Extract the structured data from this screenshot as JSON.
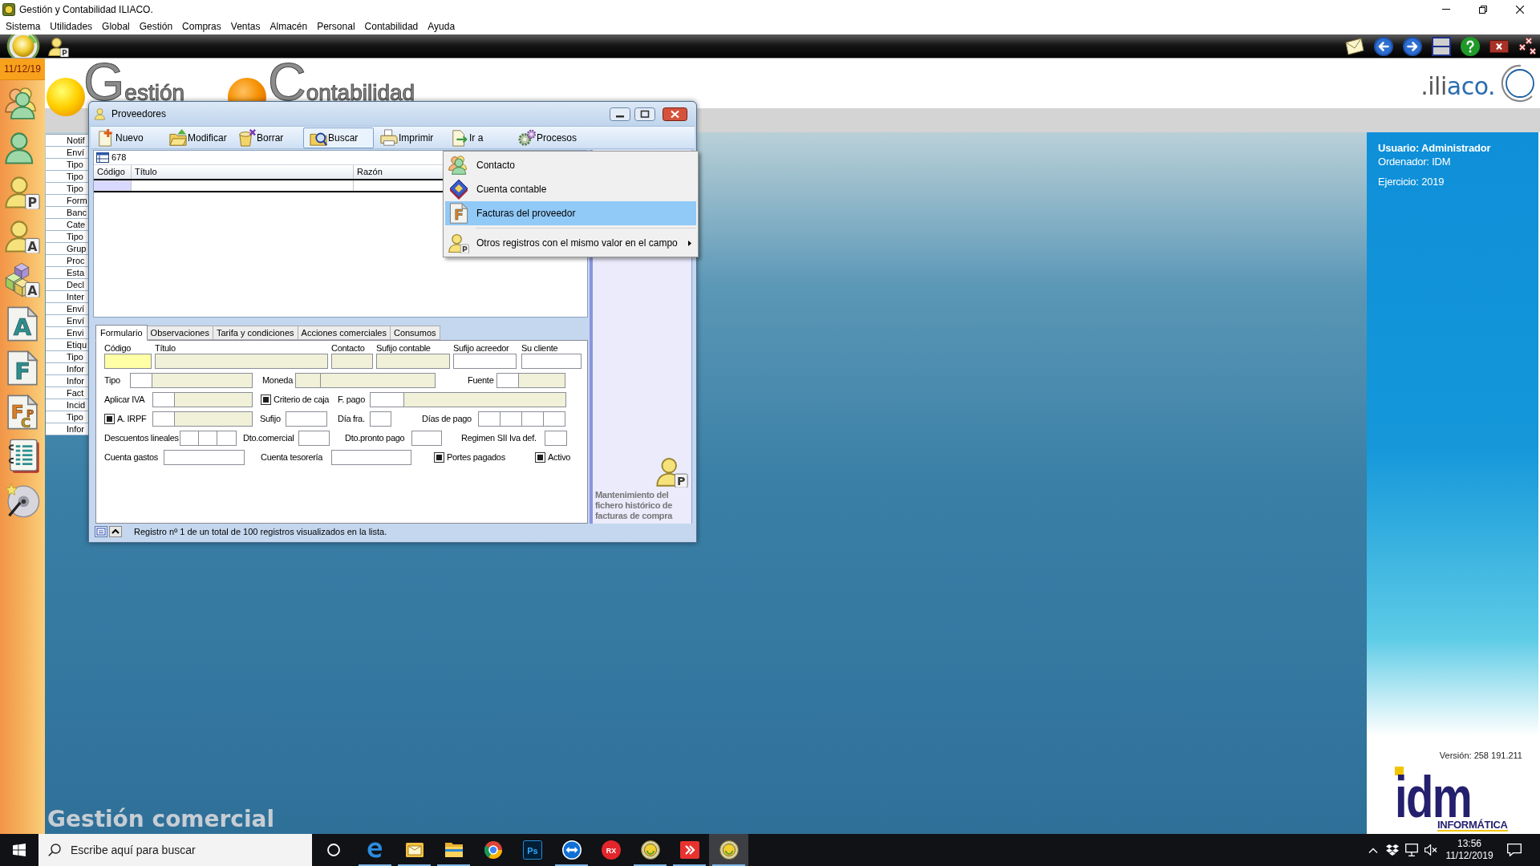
{
  "window": {
    "title": "Gestión y Contabilidad ILIACO."
  },
  "menu": [
    "Sistema",
    "Utilidades",
    "Global",
    "Gestión",
    "Compras",
    "Ventas",
    "Almacén",
    "Personal",
    "Contabilidad",
    "Ayuda"
  ],
  "quick_access": [
    {
      "kind": "orb"
    },
    {
      "kind": "user",
      "letters": [
        "P"
      ]
    }
  ],
  "sidebar": {
    "date": "11/12/19",
    "items": [
      {
        "kind": "group"
      },
      {
        "kind": "user"
      },
      {
        "kind": "user",
        "letters": [
          "P"
        ]
      },
      {
        "kind": "user",
        "letters": [
          "A"
        ]
      },
      {
        "kind": "cubes",
        "letters": [
          "A"
        ]
      },
      {
        "kind": "page",
        "letters": [
          "A"
        ]
      },
      {
        "kind": "page",
        "letters": [
          "F"
        ]
      },
      {
        "kind": "page",
        "letters": [
          "F",
          "P",
          "C"
        ]
      },
      {
        "kind": "notebook"
      },
      {
        "kind": "disc"
      }
    ]
  },
  "banner": {
    "logos": [
      "Gestión",
      "Contabilidad"
    ],
    "brand": [
      ".ili",
      "aco."
    ]
  },
  "list_panel": {
    "items": [
      "Notif",
      "Enví",
      "Tipo",
      "Tipo",
      "Tipo",
      "Form",
      "Banc",
      "Cate",
      "Tipo",
      "Grup",
      "Proc",
      "Esta",
      "Decl",
      "Inter",
      "Enví",
      "Enví",
      "Envi",
      "Etiqu",
      "Tipo",
      "Infor",
      "Infor",
      "Fact",
      "Incid",
      "Tipo",
      "Infor"
    ]
  },
  "proveedores": {
    "title": "Proveedores",
    "toolbar": [
      {
        "label": "Nuevo",
        "pressed": false
      },
      {
        "label": "Modificar",
        "pressed": false
      },
      {
        "label": "Borrar",
        "pressed": false
      },
      {
        "label": "Buscar",
        "pressed": true
      },
      {
        "label": "Imprimir",
        "pressed": false
      },
      {
        "label": "Ir a",
        "pressed": false
      },
      {
        "label": "Procesos",
        "pressed": false
      }
    ],
    "record": "678",
    "columns": [
      {
        "label": "Código",
        "selected": true
      },
      {
        "label": "Título",
        "selected": false
      },
      {
        "label": "Razón",
        "selected": false
      }
    ],
    "tabs": [
      {
        "label": "Formulario",
        "selected": true
      },
      {
        "label": "Observaciones",
        "selected": false
      },
      {
        "label": "Tarifa y condiciones",
        "selected": false
      },
      {
        "label": "Acciones comerciales",
        "selected": false
      },
      {
        "label": "Consumos",
        "selected": false
      }
    ],
    "form": {
      "rows": [
        {
          "kind": "stacked",
          "items": [
            {
              "label": "Código",
              "boxes": [
                {
                  "kind": "key"
                }
              ]
            },
            {
              "label": "Título",
              "boxes": [
                {
                  "kind": "readonly"
                }
              ]
            },
            {
              "label": "Contacto",
              "boxes": [
                {
                  "kind": "readonly"
                }
              ]
            },
            {
              "label": "Sufijo contable",
              "boxes": [
                {
                  "kind": "readonly"
                }
              ]
            },
            {
              "label": "Sufijo acreedor",
              "boxes": [
                {
                  "kind": "input"
                }
              ]
            },
            {
              "label": "Su cliente",
              "boxes": [
                {
                  "kind": "input"
                }
              ]
            }
          ]
        },
        {
          "kind": "inline",
          "items": [
            {
              "kind": "field",
              "label": "Tipo",
              "boxes": [
                {
                  "kind": "input"
                },
                {
                  "kind": "readonly"
                }
              ]
            },
            {
              "kind": "field",
              "label": "Moneda",
              "boxes": [
                {
                  "kind": "readonly"
                },
                {
                  "kind": "readonly"
                }
              ]
            },
            {
              "kind": "field",
              "label": "Fuente",
              "boxes": [
                {
                  "kind": "input"
                },
                {
                  "kind": "readonly"
                }
              ]
            }
          ]
        },
        {
          "kind": "inline",
          "items": [
            {
              "kind": "field",
              "label": "Aplicar IVA",
              "boxes": [
                {
                  "kind": "input"
                },
                {
                  "kind": "readonly"
                }
              ]
            },
            {
              "kind": "check",
              "label": "Criterio de caja",
              "checked": true
            },
            {
              "kind": "field",
              "label": "F. pago",
              "boxes": [
                {
                  "kind": "input"
                },
                {
                  "kind": "readonly"
                }
              ]
            }
          ]
        },
        {
          "kind": "inline",
          "items": [
            {
              "kind": "check",
              "label": "A. IRPF",
              "checked": true,
              "boxes": [
                {
                  "kind": "input"
                },
                {
                  "kind": "readonly"
                }
              ]
            },
            {
              "kind": "field",
              "label": "Sufijo",
              "boxes": [
                {
                  "kind": "input"
                }
              ]
            },
            {
              "kind": "field",
              "label": "Día fra.",
              "boxes": [
                {
                  "kind": "input"
                }
              ]
            },
            {
              "kind": "field",
              "label": "Días de pago",
              "boxes": [
                {
                  "kind": "input"
                },
                {
                  "kind": "input"
                },
                {
                  "kind": "input"
                },
                {
                  "kind": "input"
                }
              ]
            }
          ]
        },
        {
          "kind": "inline",
          "items": [
            {
              "kind": "field",
              "label": "Descuentos lineales",
              "boxes": [
                {
                  "kind": "input"
                },
                {
                  "kind": "input"
                },
                {
                  "kind": "input"
                }
              ]
            },
            {
              "kind": "field",
              "label": "Dto.comercial",
              "boxes": [
                {
                  "kind": "input"
                }
              ]
            },
            {
              "kind": "field",
              "label": "Dto.pronto pago",
              "boxes": [
                {
                  "kind": "input"
                }
              ]
            },
            {
              "kind": "field",
              "label": "Regimen SII Iva def.",
              "boxes": [
                {
                  "kind": "input"
                }
              ]
            }
          ]
        },
        {
          "kind": "inline",
          "items": [
            {
              "kind": "field",
              "label": "Cuenta gastos",
              "boxes": [
                {
                  "kind": "input"
                }
              ]
            },
            {
              "kind": "field",
              "label": "Cuenta tesorería",
              "boxes": [
                {
                  "kind": "input"
                }
              ]
            },
            {
              "kind": "check",
              "label": "Portes pagados",
              "checked": true
            },
            {
              "kind": "check",
              "label": "Activo",
              "checked": true
            }
          ]
        }
      ]
    },
    "note": "Mantenimiento del fichero histórico de facturas de compra",
    "note_icon": {
      "kind": "user",
      "letters": [
        "P"
      ]
    },
    "status": "Registro nº 1 de un total de 100 registros visualizados en la lista."
  },
  "context_menu": {
    "items": [
      {
        "kind": "group",
        "label": "Contacto",
        "selected": false,
        "submenu": false
      },
      {
        "kind": "ledger",
        "label": "Cuenta contable",
        "selected": false,
        "submenu": false
      },
      {
        "kind": "page",
        "letters": [
          "F"
        ],
        "label": "Facturas del proveedor",
        "selected": true,
        "submenu": false
      },
      {
        "kind": "user",
        "letters": [
          "P"
        ],
        "label": "Otros registros con el mismo valor en el campo",
        "selected": false,
        "submenu": true
      }
    ]
  },
  "desktop": {
    "caption": "Gestión comercial"
  },
  "session": {
    "lines": [
      "Usuario: Administrador",
      "Ordenador: IDM",
      "Ejercicio: 2019"
    ],
    "version": "Versión: 258 191.211",
    "logo": "idm",
    "logo_subtitle": "INFORMÁTICA"
  },
  "taskbar": {
    "search_placeholder": "Escribe aquí para buscar",
    "apps": [
      {
        "kind": "browser",
        "running": true,
        "active": false
      },
      {
        "kind": "mail",
        "running": true,
        "active": false
      },
      {
        "kind": "folder",
        "running": true,
        "active": false
      },
      {
        "kind": "ring",
        "running": false,
        "active": false
      },
      {
        "kind": "tile",
        "letters": [
          "Ps"
        ],
        "running": false,
        "active": false
      },
      {
        "kind": "remote",
        "running": true,
        "active": false
      },
      {
        "kind": "badge",
        "letters": [
          "RX"
        ],
        "running": false,
        "active": false
      },
      {
        "kind": "coin",
        "running": true,
        "active": false
      },
      {
        "kind": "arrows",
        "running": true,
        "active": false
      },
      {
        "kind": "coin",
        "running": true,
        "active": true
      }
    ],
    "time": "13:56",
    "date": "11/12/2019"
  }
}
